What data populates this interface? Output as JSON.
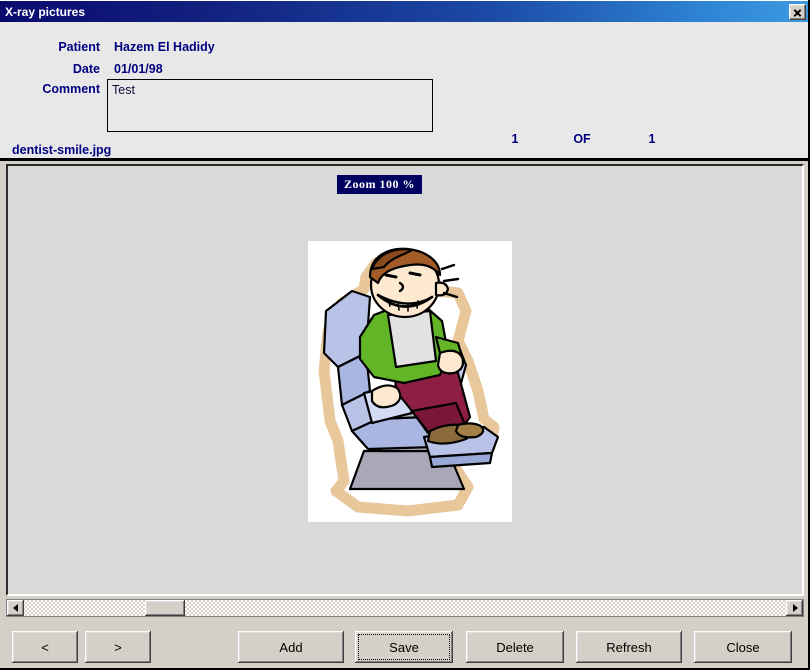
{
  "window": {
    "title": "X-ray pictures",
    "close_icon": "close-icon"
  },
  "form": {
    "patient_label": "Patient",
    "patient_value": "Hazem El Hadidy",
    "date_label": "Date",
    "date_value": "01/01/98",
    "comment_label": "Comment",
    "comment_value": "Test",
    "comment_placeholder": ""
  },
  "status": {
    "filename": "dentist-smile.jpg",
    "page_current": "1",
    "page_of": "OF",
    "page_total": "1"
  },
  "viewer": {
    "zoom_badge": "Zoom 100 %",
    "image_alt": "dentist-chair-clipart"
  },
  "scrollbar": {
    "left_arrow": "triangle-left-icon",
    "right_arrow": "triangle-right-icon",
    "thumb": "scroll-thumb"
  },
  "buttons": {
    "prev": "<",
    "next": ">",
    "add": "Add",
    "save": "Save",
    "delete": "Delete",
    "refresh": "Refresh",
    "close": "Close"
  },
  "colors": {
    "title_gradient_start": "#0a0a6e",
    "title_gradient_end": "#3d9ae0",
    "label_navy": "#000080",
    "zoom_badge_bg": "#000060",
    "dialog_face": "#d4d0c8",
    "header_face": "#e8e8e8",
    "viewer_face": "#d9d9d9"
  }
}
